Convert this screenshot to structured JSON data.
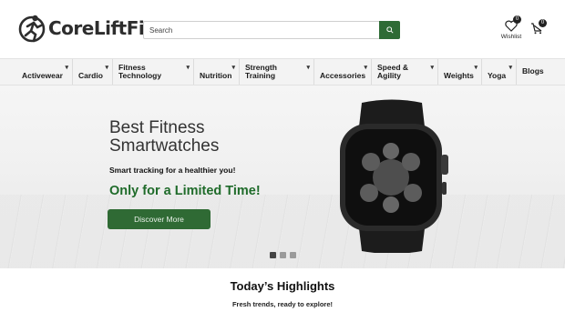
{
  "brand": {
    "name": "CoreLiftFit"
  },
  "search": {
    "placeholder": "Search"
  },
  "wishlist": {
    "label": "Wishlist",
    "count": "0"
  },
  "cart": {
    "count": "0"
  },
  "nav": [
    {
      "label": "Activewear",
      "dropdown": true
    },
    {
      "label": "Cardio",
      "dropdown": true
    },
    {
      "label": "Fitness Technology",
      "dropdown": true
    },
    {
      "label": "Nutrition",
      "dropdown": true
    },
    {
      "label": "Strength Training",
      "dropdown": true
    },
    {
      "label": "Accessories",
      "dropdown": true
    },
    {
      "label": "Speed & Agility",
      "dropdown": true
    },
    {
      "label": "Weights",
      "dropdown": true
    },
    {
      "label": "Yoga",
      "dropdown": true
    },
    {
      "label": "Blogs",
      "dropdown": false
    }
  ],
  "hero": {
    "title": "Best Fitness Smartwatches",
    "subtitle": "Smart tracking for a healthier you!",
    "offer": "Only for a Limited Time!",
    "cta": "Discover More",
    "slides": 3,
    "active_slide": 1
  },
  "highlights": {
    "title": "Today’s Highlights",
    "subtitle": "Fresh trends, ready to explore!"
  },
  "colors": {
    "accent": "#2f6a34",
    "offer": "#1f6b2a",
    "nav_bg": "#f3f3f3"
  }
}
